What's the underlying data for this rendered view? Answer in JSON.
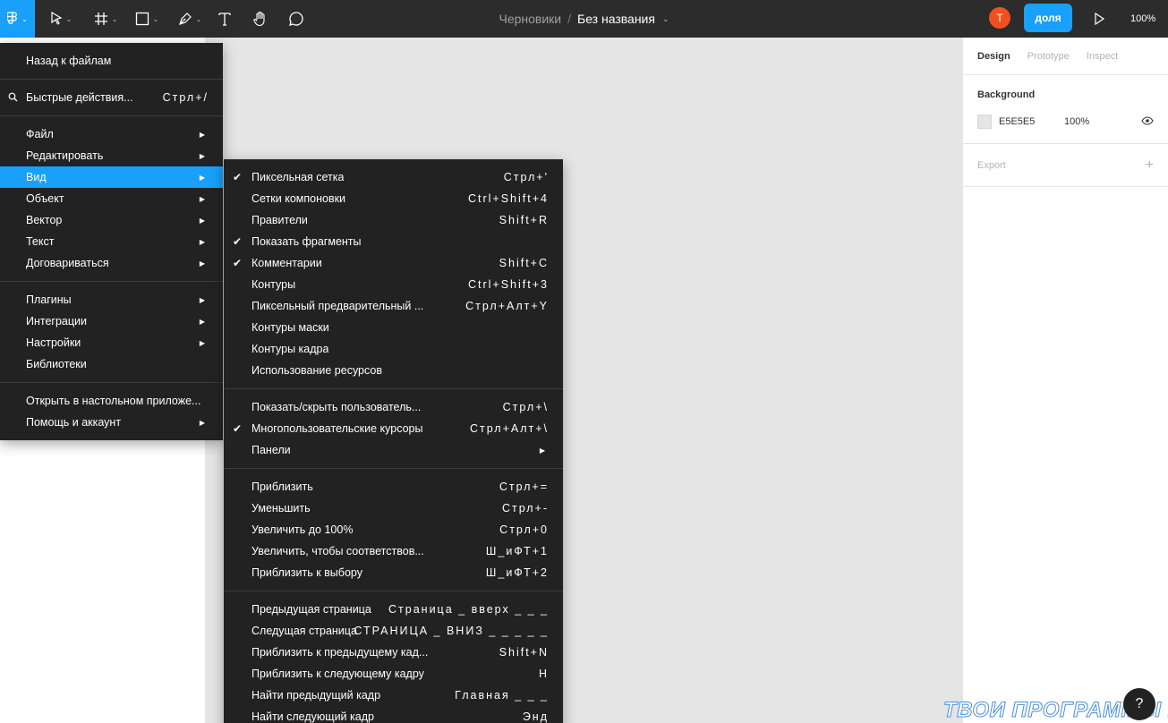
{
  "toolbar": {
    "tools": [
      {
        "name": "figma-menu",
        "icon": "figma-logo-icon"
      },
      {
        "name": "move",
        "icon": "move-cursor-icon"
      },
      {
        "name": "frame",
        "icon": "frame-hash-icon"
      },
      {
        "name": "shape",
        "icon": "rectangle-icon"
      },
      {
        "name": "pen",
        "icon": "pen-icon"
      },
      {
        "name": "text",
        "icon": "text-t-icon"
      },
      {
        "name": "hand",
        "icon": "hand-icon"
      },
      {
        "name": "comment",
        "icon": "comment-bubble-icon"
      }
    ],
    "breadcrumb_parent": "Черновики",
    "breadcrumb_sep": "/",
    "title": "Без названия",
    "avatar_initial": "T",
    "share_label": "доля",
    "zoom": "100%"
  },
  "right_panel": {
    "tabs": [
      "Design",
      "Prototype",
      "Inspect"
    ],
    "background_title": "Background",
    "bg_hex": "E5E5E5",
    "bg_opacity": "100%",
    "export_label": "Export",
    "export_plus": "+"
  },
  "main_menu": {
    "items": [
      {
        "label": "Назад к файлам"
      },
      {
        "label": "Быстрые действия...",
        "shortcut": "Стрл+/",
        "icon": "search-icon"
      },
      {
        "label": "Файл",
        "submenu": true
      },
      {
        "label": "Редактировать",
        "submenu": true
      },
      {
        "label": "Вид",
        "submenu": true,
        "active": true
      },
      {
        "label": "Объект",
        "submenu": true
      },
      {
        "label": "Вектор",
        "submenu": true
      },
      {
        "label": "Текст",
        "submenu": true
      },
      {
        "label": "Договариваться",
        "submenu": true
      },
      {
        "label": "Плагины",
        "submenu": true
      },
      {
        "label": "Интеграции",
        "submenu": true
      },
      {
        "label": "Настройки",
        "submenu": true
      },
      {
        "label": "Библиотеки"
      },
      {
        "label": "Открыть в настольном приложе..."
      },
      {
        "label": "Помощь и аккаунт",
        "submenu": true
      }
    ]
  },
  "view_menu": {
    "items": [
      {
        "label": "Пиксельная сетка",
        "shortcut": "Стрл+'",
        "checked": true
      },
      {
        "label": "Сетки компоновки",
        "shortcut": "Ctrl+Shift+4"
      },
      {
        "label": "Правители",
        "shortcut": "Shift+R"
      },
      {
        "label": "Показать фрагменты",
        "checked": true
      },
      {
        "label": "Комментарии",
        "shortcut": "Shift+C",
        "checked": true
      },
      {
        "label": "Контуры",
        "shortcut": "Ctrl+Shift+3"
      },
      {
        "label": "Пиксельный предварительный ...",
        "shortcut": "Стрл+Алт+Y"
      },
      {
        "label": "Контуры маски"
      },
      {
        "label": "Контуры кадра"
      },
      {
        "label": "Использование ресурсов"
      },
      {
        "label": "Показать/скрыть пользователь...",
        "shortcut": "Стрл+\\"
      },
      {
        "label": "Многопользовательские курсоры",
        "shortcut": "Стрл+Алт+\\",
        "checked": true
      },
      {
        "label": "Панели",
        "submenu": true
      },
      {
        "label": "Приблизить",
        "shortcut": "Стрл+="
      },
      {
        "label": "Уменьшить",
        "shortcut": "Стрл+-"
      },
      {
        "label": "Увеличить до 100%",
        "shortcut": "Стрл+0"
      },
      {
        "label": "Увеличить, чтобы соответствов...",
        "shortcut": "Ш_иФТ+1"
      },
      {
        "label": "Приблизить к выбору",
        "shortcut": "Ш_иФТ+2"
      },
      {
        "label": "Предыдущая страница",
        "shortcut": "Страница _ вверх _ _ _"
      },
      {
        "label": "Следущая страница",
        "shortcut": "СТРАНИЦА _ ВНИЗ _ _ _ _ _"
      },
      {
        "label": "Приблизить к предыдущему кад...",
        "shortcut": "Shift+N"
      },
      {
        "label": "Приблизить к следующему кадру",
        "shortcut": "H"
      },
      {
        "label": "Найти предыдущий кадр",
        "shortcut": "Главная _ _ _"
      },
      {
        "label": "Найти следующий кадр",
        "shortcut": "Энд"
      }
    ]
  },
  "watermark": "ТВОИ ПРОГРАММЫ РУ",
  "help_label": "?"
}
